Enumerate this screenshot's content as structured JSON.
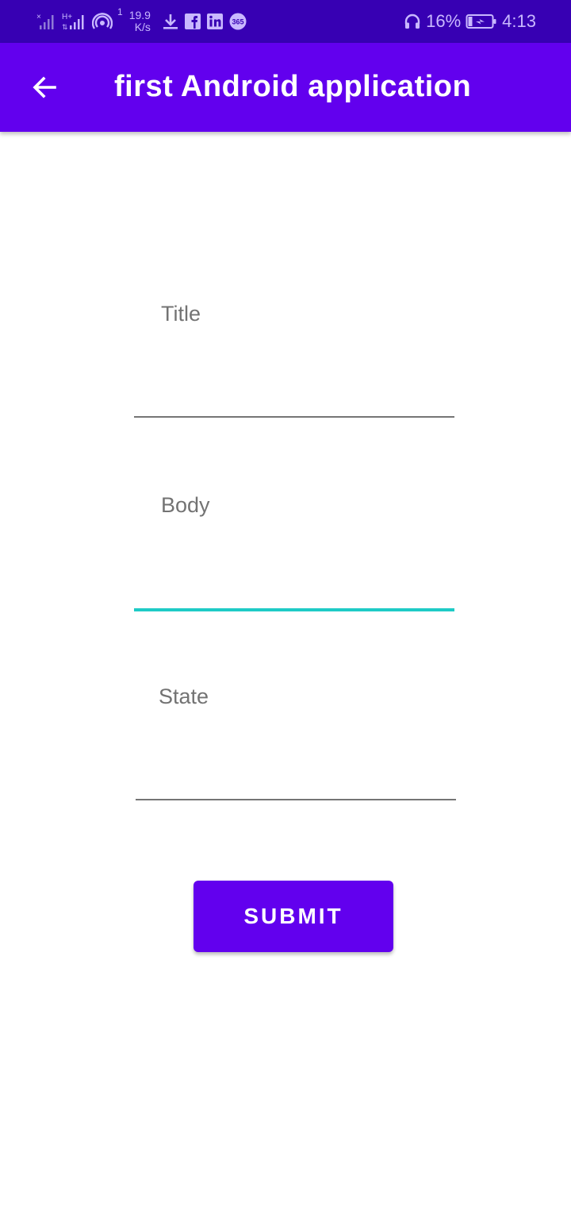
{
  "status_bar": {
    "network_speed_value": "19.9",
    "network_speed_unit": "K/s",
    "hotspot_count": "1",
    "battery_percent": "16%",
    "time": "4:13",
    "icons": [
      "signal-no-sim-icon",
      "signal-h-plus-icon",
      "hotspot-icon",
      "download-icon",
      "facebook-icon",
      "linkedin-icon",
      "app-365-icon",
      "headphones-icon",
      "battery-charging-icon"
    ]
  },
  "app_bar": {
    "back_icon": "arrow-back-icon",
    "title": "first Android application"
  },
  "form": {
    "title_field": {
      "label": "Title",
      "value": ""
    },
    "body_field": {
      "label": "Body",
      "value": ""
    },
    "state_field": {
      "label": "State",
      "value": ""
    },
    "submit_label": "SUBMIT"
  },
  "colors": {
    "status_bar": "#3700b3",
    "primary": "#6200ee",
    "focus_accent": "#1ecbc6",
    "label_gray": "#737373"
  }
}
